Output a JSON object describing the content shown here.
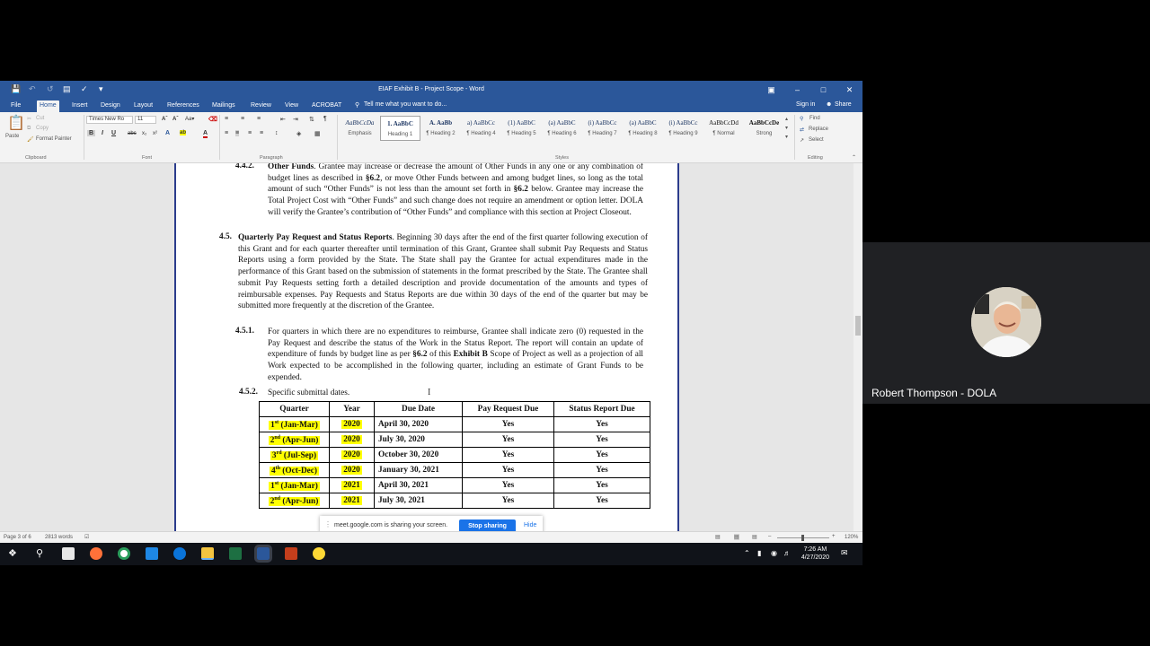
{
  "word": {
    "doc_title": "EIAF Exhibit B - Project Scope - Word",
    "tabs": [
      "File",
      "Home",
      "Insert",
      "Design",
      "Layout",
      "References",
      "Mailings",
      "Review",
      "View",
      "ACROBAT"
    ],
    "tell_me": "Tell me what you want to do...",
    "sign_in": "Sign in",
    "share": "Share",
    "clipboard": {
      "paste": "Paste",
      "cut": "Cut",
      "copy": "Copy",
      "format_painter": "Format Painter",
      "label": "Clipboard"
    },
    "font": {
      "name": "Times New Ro",
      "size": "11",
      "label": "Font"
    },
    "paragraph_label": "Paragraph",
    "styles_label": "Styles",
    "styles": [
      {
        "preview": "AaBbCcDa",
        "name": "Emphasis"
      },
      {
        "preview": "1. AaBbC",
        "name": "Heading 1"
      },
      {
        "preview": "A. AaBb",
        "name": "¶ Heading 2"
      },
      {
        "preview": "a) AaBbCc",
        "name": "¶ Heading 4"
      },
      {
        "preview": "(1) AaBbC",
        "name": "¶ Heading 5"
      },
      {
        "preview": "(a) AaBbC",
        "name": "¶ Heading 6"
      },
      {
        "preview": "(i) AaBbCc",
        "name": "¶ Heading 7"
      },
      {
        "preview": "(a) AaBbC",
        "name": "¶ Heading 8"
      },
      {
        "preview": "(i) AaBbCc",
        "name": "¶ Heading 9"
      },
      {
        "preview": "AaBbCcDd",
        "name": "¶ Normal"
      },
      {
        "preview": "AaBbCcDe",
        "name": "Strong"
      }
    ],
    "editing": {
      "find": "Find",
      "replace": "Replace",
      "select": "Select",
      "label": "Editing"
    },
    "status": {
      "page": "Page 3 of 6",
      "words": "2813 words",
      "zoom": "120%"
    }
  },
  "document": {
    "s442": {
      "num": "4.4.2.",
      "title": "Other Funds",
      "t1": "Grantee may increase or decrease the amount of Other Funds in any one or any combination of budget lines as described in ",
      "ref1": "§6.2",
      "t2": ", or move Other Funds between and among budget lines, so long as the total amount of such “Other Funds” is not less than the amount set forth in ",
      "ref2": "§6.2",
      "t3": " below.  Grantee may increase the Total Project Cost with “Other Funds” and such change does not require an amendment or option letter.  DOLA will verify the Grantee’s contribution of “Other Funds” and compliance with this section at Project Closeout."
    },
    "s45": {
      "num": "4.5.",
      "title": "Quarterly Pay Request and Status Reports",
      "text": "Beginning 30 days after the end of the first quarter following execution of this Grant and for each quarter thereafter until termination of this Grant, Grantee shall submit Pay Requests and Status Reports using a form provided by the State.  The State shall pay the Grantee for actual expenditures made in the performance of this Grant based on the submission of statements in the format prescribed by the State.  The Grantee shall submit Pay Requests setting forth a detailed description and provide documentation of the amounts and types of reimbursable expenses.  Pay Requests and Status Reports are due within 30 days of the end of the quarter but may be submitted more frequently at the discretion of the Grantee."
    },
    "s451": {
      "num": "4.5.1.",
      "t1": "For quarters in which there are no expenditures to reimburse, Grantee shall indicate zero (0) requested in the Pay Request and describe the status of the Work in the Status Report.  The report will contain an update of expenditure of funds by budget line as per ",
      "ref": "§6.2",
      "t2": " of this ",
      "exhibit": "Exhibit B",
      "t3": " Scope of Project as well as a projection of all Work expected to be accomplished in the following quarter, including an estimate of Grant Funds to be expended."
    },
    "s452": {
      "num": "4.5.2.",
      "text": "Specific submittal dates."
    },
    "table": {
      "headers": [
        "Quarter",
        "Year",
        "Due Date",
        "Pay Request Due",
        "Status Report Due"
      ],
      "rows": [
        {
          "ord": "1",
          "sup": "st",
          "q": " (Jan-Mar)",
          "year": "2020",
          "due": "April 30, 2020",
          "pay": "Yes",
          "status": "Yes"
        },
        {
          "ord": "2",
          "sup": "nd",
          "q": " (Apr-Jun)",
          "year": "2020",
          "due": "July 30, 2020",
          "pay": "Yes",
          "status": "Yes"
        },
        {
          "ord": "3",
          "sup": "rd",
          "q": " (Jul-Sep)",
          "year": "2020",
          "due": "October 30, 2020",
          "pay": "Yes",
          "status": "Yes"
        },
        {
          "ord": "4",
          "sup": "th",
          "q": " (Oct-Dec)",
          "year": "2020",
          "due": "January 30, 2021",
          "pay": "Yes",
          "status": "Yes"
        },
        {
          "ord": "1",
          "sup": "st",
          "q": " (Jan-Mar)",
          "year": "2021",
          "due": "April 30, 2021",
          "pay": "Yes",
          "status": "Yes"
        },
        {
          "ord": "2",
          "sup": "nd",
          "q": " (Apr-Jun)",
          "year": "2021",
          "due": "July 30, 2021",
          "pay": "Yes",
          "status": "Yes"
        }
      ]
    }
  },
  "share_bar": {
    "message": "meet.google.com is sharing your screen.",
    "stop": "Stop sharing",
    "hide": "Hide"
  },
  "taskbar": {
    "time": "7:26 AM",
    "date": "4/27/2020"
  },
  "meet": {
    "participant": "Robert Thompson - DOLA"
  },
  "colors": {
    "word_blue": "#2b579a",
    "highlight": "#ffff00",
    "meet_blue": "#1a73e8"
  }
}
